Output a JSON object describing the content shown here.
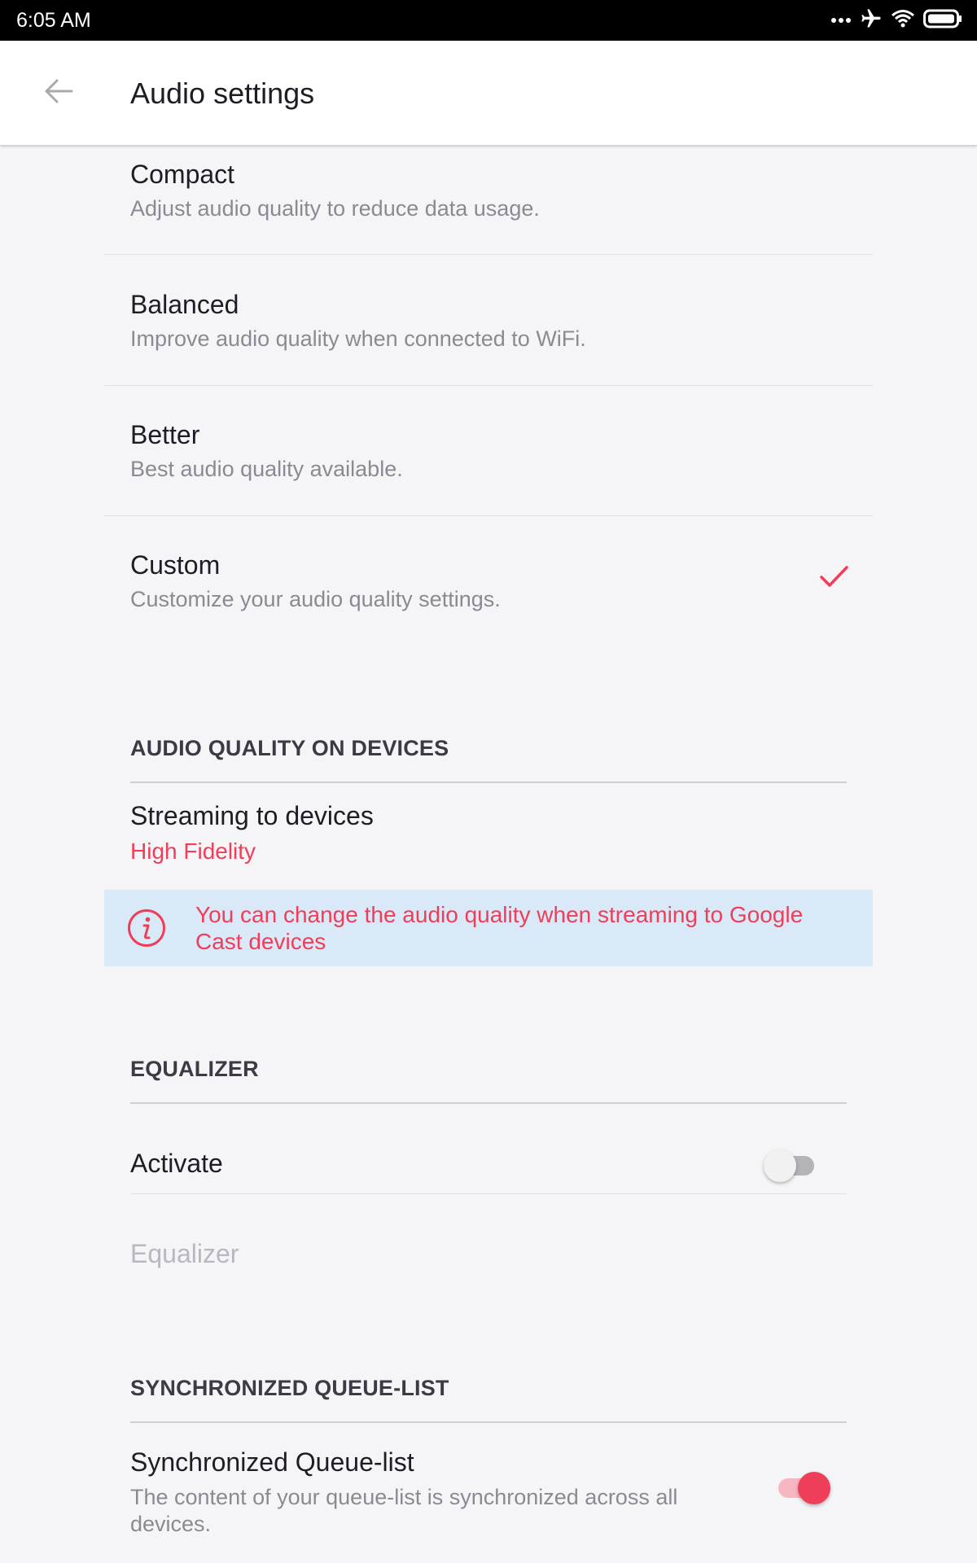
{
  "status_bar": {
    "time": "6:05 AM",
    "icons": [
      "more-dots-icon",
      "airplane-icon",
      "wifi-icon",
      "battery-icon"
    ]
  },
  "app_bar": {
    "back_icon": "arrow-back-icon",
    "title": "Audio settings"
  },
  "quality_options": [
    {
      "title": "Compact",
      "subtitle": "Adjust audio quality to reduce data usage.",
      "selected": false
    },
    {
      "title": "Balanced",
      "subtitle": "Improve audio quality when connected to WiFi.",
      "selected": false
    },
    {
      "title": "Better",
      "subtitle": "Best audio quality available.",
      "selected": false
    },
    {
      "title": "Custom",
      "subtitle": "Customize your audio quality settings.",
      "selected": true
    }
  ],
  "devices_section": {
    "header": "AUDIO QUALITY ON DEVICES",
    "streaming_title": "Streaming to devices",
    "streaming_value": "High Fidelity",
    "info_text": "You can change the audio quality when streaming to Google Cast devices",
    "info_icon": "info-icon"
  },
  "equalizer_section": {
    "header": "EQUALIZER",
    "activate_label": "Activate",
    "activate_on": false,
    "equalizer_label": "Equalizer"
  },
  "queue_section": {
    "header": "SYNCHRONIZED QUEUE-LIST",
    "title": "Synchronized Queue-list",
    "subtitle": "The content of your queue-list is synchronized across all devices.",
    "enabled": true
  },
  "colors": {
    "accent": "#ef3e5a",
    "info_background": "#d9e9f7",
    "page_background": "#f5f5f7"
  }
}
